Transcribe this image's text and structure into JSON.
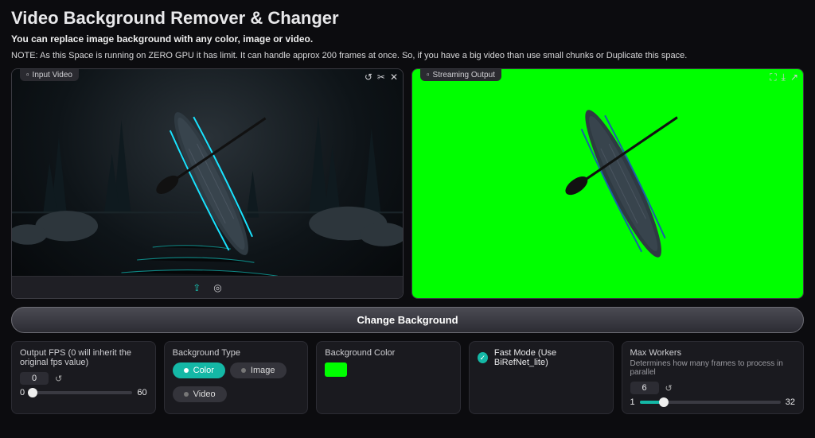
{
  "header": {
    "title": "Video Background Remover & Changer",
    "subtitle": "You can replace image background with any color, image or video.",
    "note": "NOTE: As this Space is running on ZERO GPU it has limit. It can handle approx 200 frames at once. So, if you have a big video than use small chunks or Duplicate this space."
  },
  "input_box": {
    "label": "Input Video",
    "icon": "webcam-icon"
  },
  "output_box": {
    "label": "Streaming Output"
  },
  "action": {
    "change_label": "Change Background"
  },
  "fps": {
    "label": "Output FPS (0 will inherit the original fps value)",
    "value": "0",
    "min": "0",
    "max": "60"
  },
  "bg_type": {
    "label": "Background Type",
    "options": {
      "color": "Color",
      "image": "Image",
      "video": "Video"
    },
    "selected": "color"
  },
  "bg_color": {
    "label": "Background Color",
    "value": "#00ff00"
  },
  "fast_mode": {
    "label": "Fast Mode (Use BiRefNet_lite)",
    "checked": true
  },
  "workers": {
    "label": "Max Workers",
    "desc": "Determines how many frames to process in parallel",
    "value": "6",
    "min": "1",
    "max": "32"
  }
}
